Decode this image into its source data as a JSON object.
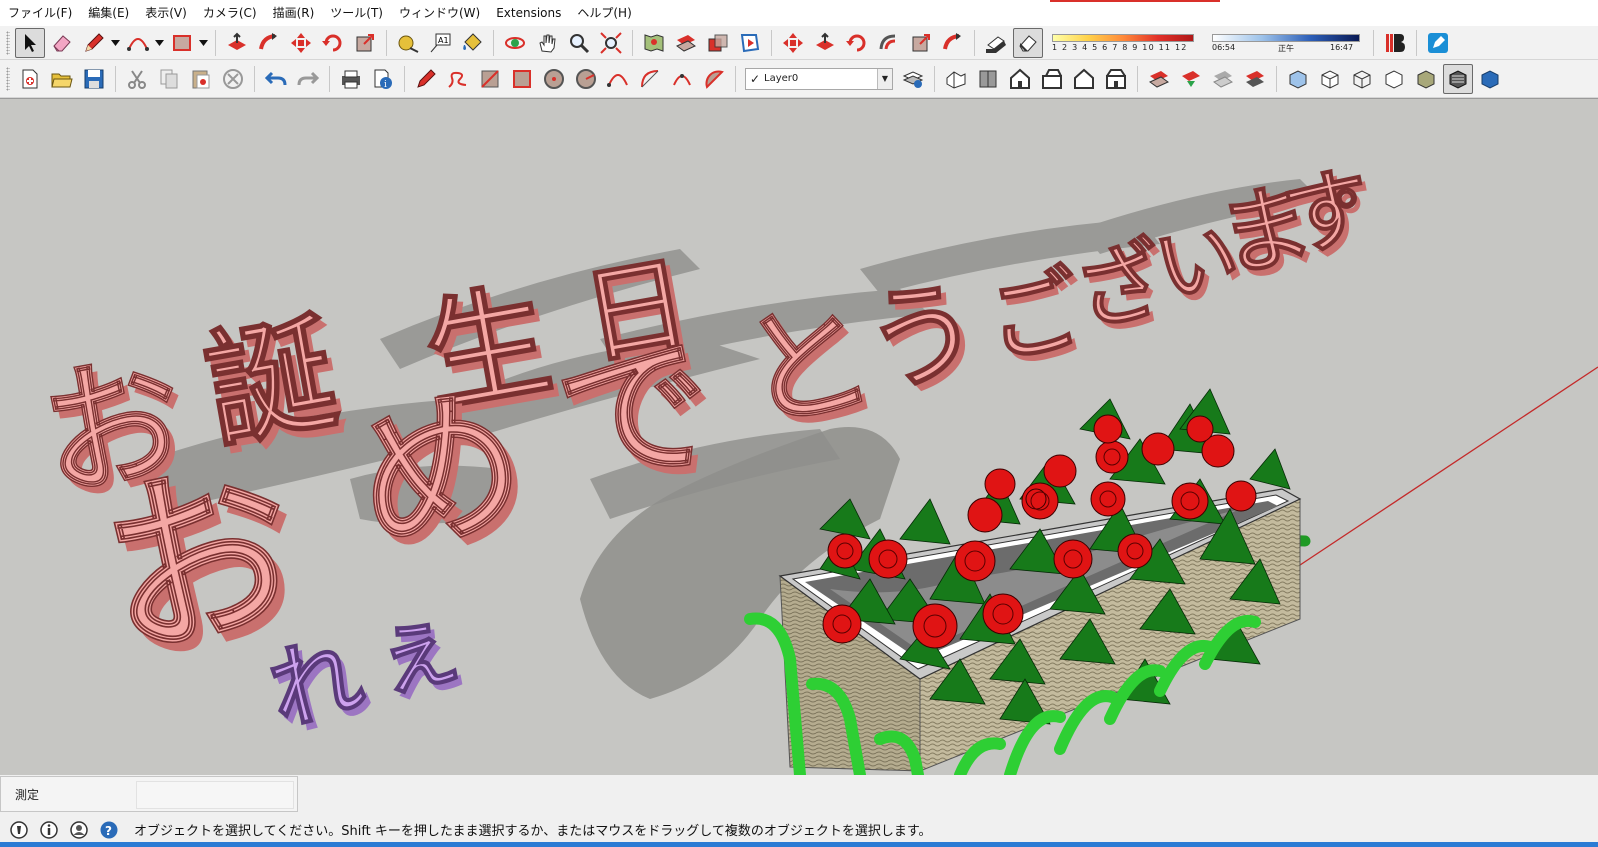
{
  "menu": [
    "ファイル(F)",
    "編集(E)",
    "表示(V)",
    "カメラ(C)",
    "描画(R)",
    "ツール(T)",
    "ウィンドウ(W)",
    "Extensions",
    "ヘルプ(H)"
  ],
  "toolbar1": {
    "tools": [
      "select-tool",
      "eraser-tool",
      "pencil-tool",
      "arc-tool",
      "rectangle-tool",
      "push-pull-tool",
      "follow-me-tool",
      "move-tool",
      "rotate-tool",
      "scale-tool",
      "tape-measure-tool",
      "text-tool",
      "paint-bucket-tool",
      "orbit-tool",
      "pan-tool",
      "zoom-tool",
      "zoom-extents-tool",
      "position-camera-tool",
      "look-around-tool",
      "walk-tool",
      "section-plane-tool",
      "intersect-faces-tool",
      "outer-shell-tool",
      "fillet-tool",
      "trim-tool",
      "extend-tool",
      "stamp-tool",
      "shadow-toggle",
      "fog-toggle",
      "dynamic-components-tool",
      "style-builder-tool"
    ],
    "shadow_months": "1 2 3 4 5 6 7 8 9 10 11 12",
    "time_start": "06:54",
    "time_mid": "正午",
    "time_end": "16:47"
  },
  "toolbar2": {
    "tools": [
      "new-model",
      "open-model",
      "save-model",
      "cut",
      "copy",
      "paste",
      "erase",
      "undo",
      "redo",
      "print",
      "model-info",
      "line",
      "freehand",
      "rectangle",
      "rotated-rectangle",
      "circle",
      "polygon",
      "arc",
      "two-point-arc",
      "three-point-arc",
      "pie"
    ],
    "layer_name": "Layer0",
    "layer_check": "✓",
    "views": [
      "iso",
      "top",
      "front",
      "right",
      "back",
      "left"
    ],
    "styles": [
      "x-ray",
      "back-edges",
      "wireframe",
      "hidden-line",
      "shaded",
      "shaded-with-textures",
      "monochrome"
    ]
  },
  "scene": {
    "line1": [
      "お",
      "誕",
      "生",
      "日"
    ],
    "line2": [
      "お",
      "め",
      "で",
      "と",
      "う",
      "ご",
      "ざ",
      "い",
      "ま",
      "す",
      "。"
    ],
    "signature": [
      "れ",
      "ぇ"
    ],
    "text_color": "#f4a7a4",
    "text_side_color": "#c9706e",
    "signature_color": "#cda2ee",
    "rose_color": "#e01414",
    "leaf_color": "#177a1a",
    "fence_color": "#2ecf34",
    "basket_color": "#b5ac8f",
    "ground_color": "#c6c6c3"
  },
  "measurements": {
    "label": "測定",
    "value": ""
  },
  "status": {
    "message": "オブジェクトを選択してください。Shift キーを押したまま選択するか、またはマウスをドラッグして複数のオブジェクトを選択します。"
  }
}
